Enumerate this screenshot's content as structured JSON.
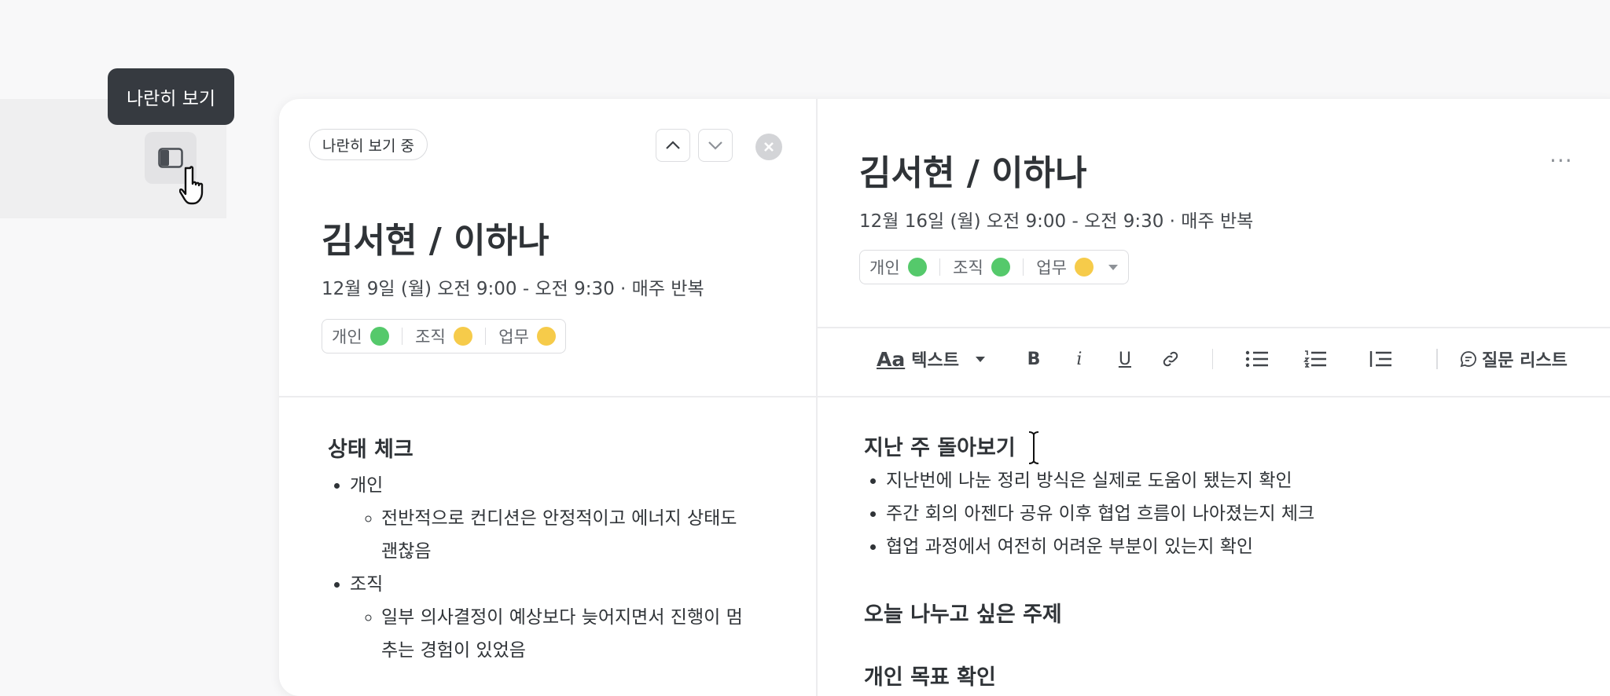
{
  "tooltip": {
    "text": "나란히 보기"
  },
  "left_pane": {
    "mode_pill": "나란히 보기 중",
    "title": "김서현 / 이하나",
    "date": "12월 9일 (월) 오전 9:00 - 오전 9:30 · 매주 반복",
    "tags": [
      {
        "label": "개인",
        "color": "#55c96b"
      },
      {
        "label": "조직",
        "color": "#f6cb4a"
      },
      {
        "label": "업무",
        "color": "#f6cb4a"
      }
    ],
    "section_title": "상태 체크",
    "items": [
      {
        "label": "개인",
        "sub": "전반적으로 컨디션은 안정적이고 에너지 상태도 괜찮음"
      },
      {
        "label": "조직",
        "sub": "일부 의사결정이 예상보다 늦어지면서 진행이 멈추는 경험이 있었음"
      }
    ]
  },
  "right_pane": {
    "title": "김서현 / 이하나",
    "date": "12월 16일 (월) 오전 9:00 - 오전 9:30 · 매주 반복",
    "more": "···",
    "tags": [
      {
        "label": "개인",
        "color": "#55c96b"
      },
      {
        "label": "조직",
        "color": "#55c96b"
      },
      {
        "label": "업무",
        "color": "#f6cb4a"
      }
    ],
    "toolbar": {
      "text_style_icon": "Aa",
      "text_style_label": "텍스트",
      "bold": "B",
      "italic": "i",
      "underline": "U",
      "question_list": "질문 리스트"
    },
    "section1_title": "지난 주 돌아보기",
    "section1_items": [
      "지난번에 나눈 정리 방식은 실제로 도움이 됐는지 확인",
      "주간 회의 아젠다 공유 이후 협업 흐름이 나아졌는지 체크",
      "협업 과정에서 여전히 어려운 부분이 있는지 확인"
    ],
    "section2_title": "오늘 나누고 싶은 주제",
    "section3_title": "개인 목표 확인"
  }
}
